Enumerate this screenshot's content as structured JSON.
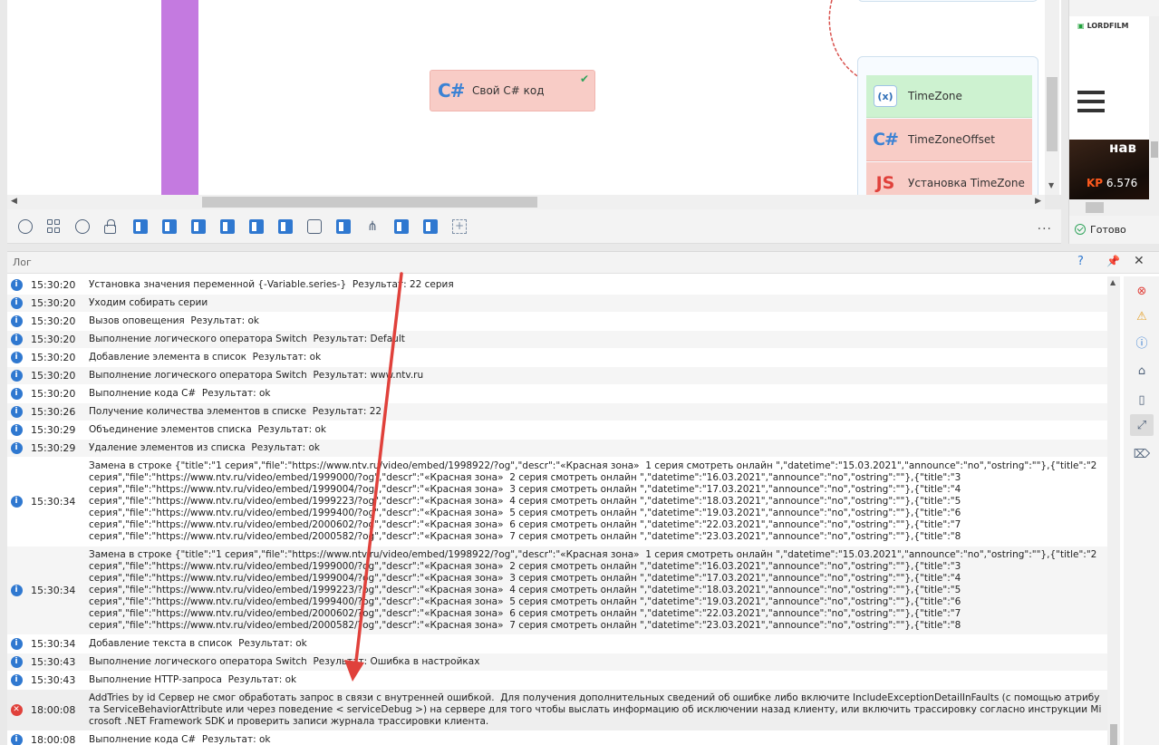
{
  "canvas": {
    "csharp_block": {
      "glyph": "C#",
      "label": "Свой C# код"
    },
    "group": {
      "items": [
        {
          "glyph": "(x)",
          "label": "TimeZone"
        },
        {
          "glyph": "C#",
          "label": "TimeZoneOffset"
        },
        {
          "glyph": "JS",
          "label": "Установка TimeZone"
        }
      ]
    }
  },
  "toolbar": {
    "icons": [
      "settings-icon",
      "apps-grid-icon",
      "user-icon",
      "lock-icon",
      "document-icon",
      "document-icon",
      "document-icon",
      "document-icon",
      "document-icon",
      "document-icon",
      "print-icon",
      "document-icon",
      "tree-icon",
      "document-icon",
      "document-icon",
      "add-block-icon"
    ],
    "more": "..."
  },
  "browser_panel": {
    "site_logo": "LORDFILM",
    "poster_title": "нав",
    "rating_label": "KP",
    "rating_value": "6.576",
    "status_text": "Готово"
  },
  "log": {
    "title": "Лог",
    "help": "?",
    "rows": [
      {
        "type": "info",
        "time": "15:30:20",
        "message": "Установка значения переменной {-Variable.series-}  Результат: 22 серия"
      },
      {
        "type": "info",
        "time": "15:30:20",
        "message": "Уходим собирать серии"
      },
      {
        "type": "info",
        "time": "15:30:20",
        "message": "Вызов оповещения  Результат: ok"
      },
      {
        "type": "info",
        "time": "15:30:20",
        "message": "Выполнение логического оператора Switch  Результат: Default"
      },
      {
        "type": "info",
        "time": "15:30:20",
        "message": "Добавление элемента в список  Результат: ok"
      },
      {
        "type": "info",
        "time": "15:30:20",
        "message": "Выполнение логического оператора Switch  Результат: www.ntv.ru"
      },
      {
        "type": "info",
        "time": "15:30:20",
        "message": "Выполнение кода C#  Результат: ok"
      },
      {
        "type": "info",
        "time": "15:30:26",
        "message": "Получение количества элементов в списке  Результат: 22"
      },
      {
        "type": "info",
        "time": "15:30:29",
        "message": "Объединение элементов списка  Результат: ok"
      },
      {
        "type": "info",
        "time": "15:30:29",
        "message": "Удаление элементов из списка  Результат: ok"
      },
      {
        "type": "info",
        "time": "15:30:34",
        "message": "Замена в строке {\"title\":\"1 серия\",\"file\":\"https://www.ntv.ru/video/embed/1998922/?og\",\"descr\":\"«Красная зона»  1 серия смотреть онлайн \",\"datetime\":\"15.03.2021\",\"announce\":\"no\",\"ostring\":\"\"},{\"title\":\"2\nсерия\",\"file\":\"https://www.ntv.ru/video/embed/1999000/?og\",\"descr\":\"«Красная зона»  2 серия смотреть онлайн \",\"datetime\":\"16.03.2021\",\"announce\":\"no\",\"ostring\":\"\"},{\"title\":\"3\nсерия\",\"file\":\"https://www.ntv.ru/video/embed/1999004/?og\",\"descr\":\"«Красная зона»  3 серия смотреть онлайн \",\"datetime\":\"17.03.2021\",\"announce\":\"no\",\"ostring\":\"\"},{\"title\":\"4\nсерия\",\"file\":\"https://www.ntv.ru/video/embed/1999223/?og\",\"descr\":\"«Красная зона»  4 серия смотреть онлайн \",\"datetime\":\"18.03.2021\",\"announce\":\"no\",\"ostring\":\"\"},{\"title\":\"5\nсерия\",\"file\":\"https://www.ntv.ru/video/embed/1999400/?og\",\"descr\":\"«Красная зона»  5 серия смотреть онлайн \",\"datetime\":\"19.03.2021\",\"announce\":\"no\",\"ostring\":\"\"},{\"title\":\"6\nсерия\",\"file\":\"https://www.ntv.ru/video/embed/2000602/?og\",\"descr\":\"«Красная зона»  6 серия смотреть онлайн \",\"datetime\":\"22.03.2021\",\"announce\":\"no\",\"ostring\":\"\"},{\"title\":\"7\nсерия\",\"file\":\"https://www.ntv.ru/video/embed/2000582/?og\",\"descr\":\"«Красная зона»  7 серия смотреть онлайн \",\"datetime\":\"23.03.2021\",\"announce\":\"no\",\"ostring\":\"\"},{\"title\":\"8"
      },
      {
        "type": "info",
        "time": "15:30:34",
        "message": "Замена в строке {\"title\":\"1 серия\",\"file\":\"https://www.ntv.ru/video/embed/1998922/?og\",\"descr\":\"«Красная зона»  1 серия смотреть онлайн \",\"datetime\":\"15.03.2021\",\"announce\":\"no\",\"ostring\":\"\"},{\"title\":\"2\nсерия\",\"file\":\"https://www.ntv.ru/video/embed/1999000/?og\",\"descr\":\"«Красная зона»  2 серия смотреть онлайн \",\"datetime\":\"16.03.2021\",\"announce\":\"no\",\"ostring\":\"\"},{\"title\":\"3\nсерия\",\"file\":\"https://www.ntv.ru/video/embed/1999004/?og\",\"descr\":\"«Красная зона»  3 серия смотреть онлайн \",\"datetime\":\"17.03.2021\",\"announce\":\"no\",\"ostring\":\"\"},{\"title\":\"4\nсерия\",\"file\":\"https://www.ntv.ru/video/embed/1999223/?og\",\"descr\":\"«Красная зона»  4 серия смотреть онлайн \",\"datetime\":\"18.03.2021\",\"announce\":\"no\",\"ostring\":\"\"},{\"title\":\"5\nсерия\",\"file\":\"https://www.ntv.ru/video/embed/1999400/?og\",\"descr\":\"«Красная зона»  5 серия смотреть онлайн \",\"datetime\":\"19.03.2021\",\"announce\":\"no\",\"ostring\":\"\"},{\"title\":\"6\nсерия\",\"file\":\"https://www.ntv.ru/video/embed/2000602/?og\",\"descr\":\"«Красная зона»  6 серия смотреть онлайн \",\"datetime\":\"22.03.2021\",\"announce\":\"no\",\"ostring\":\"\"},{\"title\":\"7\nсерия\",\"file\":\"https://www.ntv.ru/video/embed/2000582/?og\",\"descr\":\"«Красная зона»  7 серия смотреть онлайн \",\"datetime\":\"23.03.2021\",\"announce\":\"no\",\"ostring\":\"\"},{\"title\":\"8"
      },
      {
        "type": "info",
        "time": "15:30:34",
        "message": "Добавление текста в список  Результат: ok"
      },
      {
        "type": "info",
        "time": "15:30:43",
        "message": "Выполнение логического оператора Switch  Результат: Ошибка в настройках"
      },
      {
        "type": "info",
        "time": "15:30:43",
        "message": "Выполнение HTTP-запроса  Результат: ok"
      },
      {
        "type": "error",
        "time": "18:00:08",
        "message": "AddTries by id Сервер не смог обработать запрос в связи с внутренней ошибкой.  Для получения дополнительных сведений об ошибке либо включите IncludeExceptionDetailInFaults (с помощью атрибута ServiceBehaviorAttribute или через поведение < serviceDebug >) на сервере для того чтобы выслать информацию об исключении назад клиенту, или включить трассировку согласно инструкции Microsoft .NET Framework SDK и проверить записи журнала трассировки клиента."
      },
      {
        "type": "info",
        "time": "18:00:08",
        "message": "Выполнение кода C#  Результат: ok"
      }
    ],
    "side_buttons": [
      "error-filter-icon",
      "warning-filter-icon",
      "info-filter-icon",
      "tag-icon",
      "phone-icon",
      "expand-icon",
      "tag-clear-icon"
    ]
  },
  "colors": {
    "purple_bar": "#c47ae0",
    "csharp_block_bg": "#f8ccc6",
    "variable_block_bg": "#cdf2d0",
    "info_icon": "#2f78d0",
    "error_icon": "#e0413b",
    "arrow": "#e0413b"
  }
}
